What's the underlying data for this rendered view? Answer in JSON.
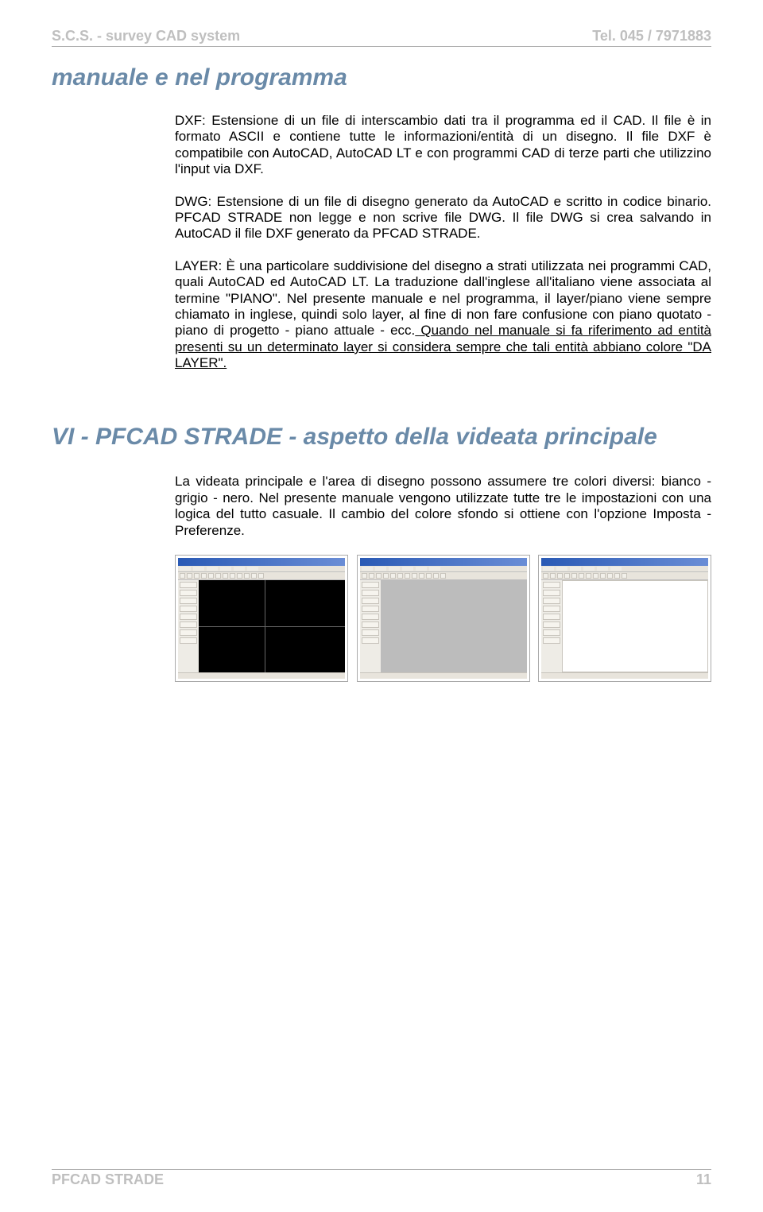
{
  "header": {
    "left": "S.C.S. - survey CAD system",
    "right": "Tel. 045 / 7971883"
  },
  "section1": {
    "title": "manuale e nel programma",
    "p1": "DXF: Estensione di un file di interscambio dati tra il programma ed il CAD. Il file è in formato ASCII e contiene tutte le informazioni/entità di un disegno. Il file DXF è compatibile con AutoCAD, AutoCAD LT e con programmi CAD di terze parti che utilizzino l'input via DXF.",
    "p2": "DWG: Estensione di un file  di disegno  generato da AutoCAD  e scritto in codice binario. PFCAD STRADE non legge e non scrive file DWG. Il file DWG si crea salvando in AutoCAD il file DXF generato da PFCAD STRADE.",
    "p3a": "LAYER: È una particolare  suddivisione  del  disegno a  strati  utilizzata  nei programmi CAD, quali AutoCAD ed AutoCAD LT. La traduzione dall'inglese all'italiano viene associata al termine \"PIANO\". Nel presente manuale e nel programma, il layer/piano viene sempre chiamato in inglese, quindi solo layer, al fine di non fare confusione con piano quotato - piano di progetto - piano attuale - ecc.",
    "p3u": " Quando nel manuale si fa riferimento ad entità presenti su un determinato layer si considera sempre che tali entità abbiano colore \"DA LAYER\"."
  },
  "section2": {
    "title": "VI - PFCAD STRADE - aspetto della videata principale",
    "p1": "La videata principale e l'area di disegno possono assumere tre colori diversi: bianco - grigio - nero. Nel presente manuale vengono utilizzate tutte tre le impostazioni con una logica del tutto casuale. Il cambio del colore sfondo si ottiene con l'opzione Imposta - Preferenze."
  },
  "footer": {
    "left": "PFCAD STRADE",
    "right": "11"
  }
}
